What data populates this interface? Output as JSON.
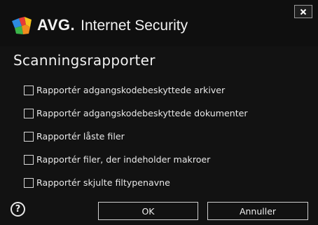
{
  "header": {
    "brand": "AVG.",
    "product": "Internet Security",
    "logo_icon": "avg-logo-icon",
    "close_icon": "close-icon"
  },
  "dialog": {
    "heading": "Scanningsrapporter",
    "options": [
      {
        "label": "Rapportér adgangskodebeskyttede arkiver",
        "checked": false
      },
      {
        "label": "Rapportér adgangskodebeskyttede dokumenter",
        "checked": false
      },
      {
        "label": "Rapportér låste filer",
        "checked": false
      },
      {
        "label": "Rapportér filer, der indeholder makroer",
        "checked": false
      },
      {
        "label": "Rapportér skjulte filtypenavne",
        "checked": false
      }
    ]
  },
  "footer": {
    "help_icon": "help-icon",
    "ok_label": "OK",
    "cancel_label": "Annuller"
  },
  "colors": {
    "background": "#121212",
    "text": "#e8e8e8",
    "border": "#cfcfcf"
  }
}
